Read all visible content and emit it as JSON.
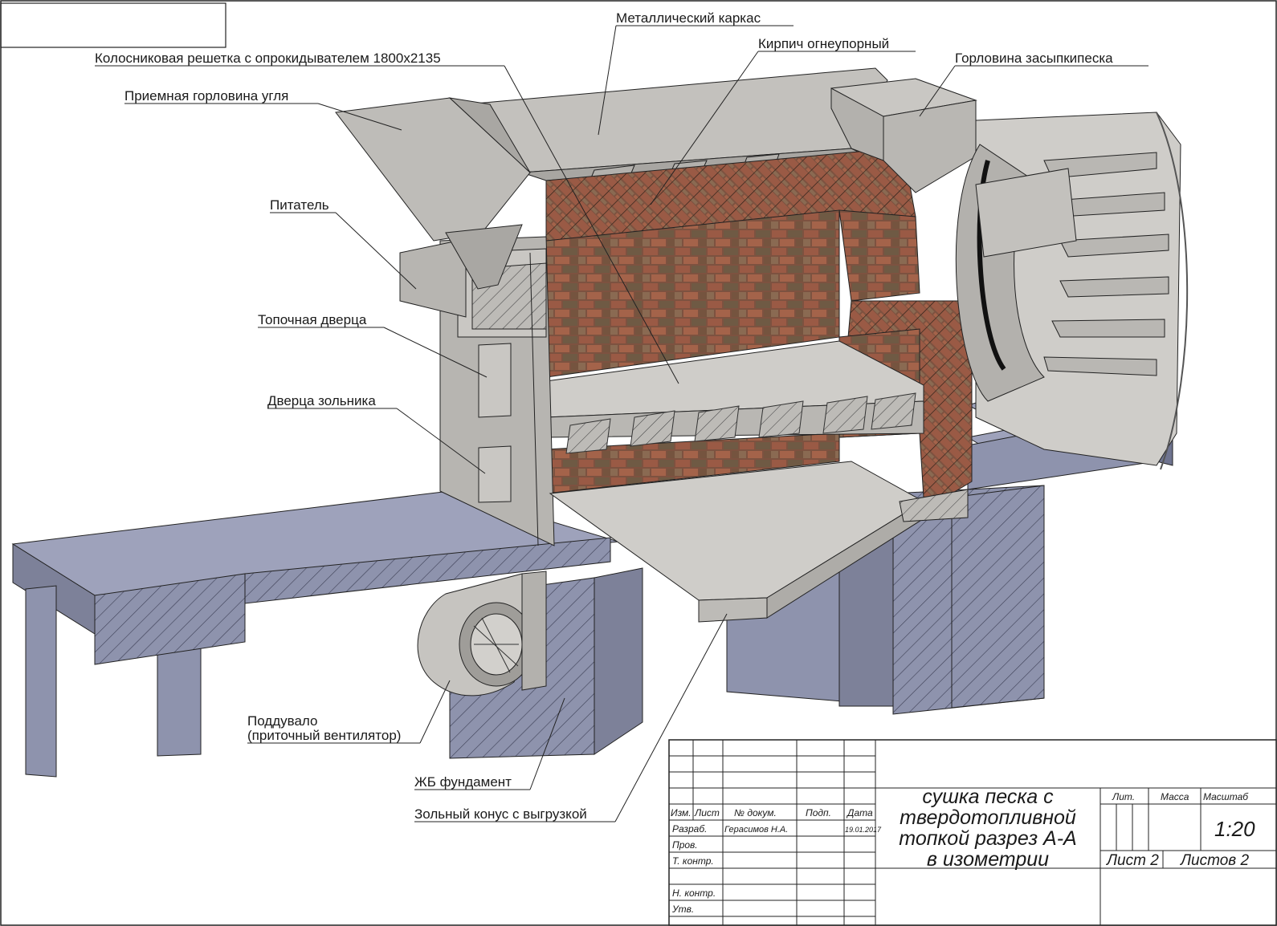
{
  "drawing": {
    "labels": [
      "Металлический каркас",
      "Кирпич огнеупорный",
      "Колосниковая решетка с опрокидывателем 1800х2135",
      "Горловина засыпкипеска",
      "Приемная горловина угля",
      "Питатель",
      "Топочная дверца",
      "Дверца зольника",
      "Поддувало",
      "(приточный вентилятор)",
      "ЖБ фундамент",
      "Зольный конус с выгрузкой"
    ]
  },
  "title_block": {
    "headers": [
      "Изм.",
      "Лист",
      "№ докум.",
      "Подп.",
      "Дата"
    ],
    "rows": [
      {
        "role": "Разраб.",
        "name": "Герасимов Н.А.",
        "date": "19.01.2017"
      },
      {
        "role": "Пров.",
        "name": "",
        "date": ""
      },
      {
        "role": "Т. контр.",
        "name": "",
        "date": ""
      },
      {
        "role": "Н. контр.",
        "name": "",
        "date": ""
      },
      {
        "role": "Утв.",
        "name": "",
        "date": ""
      }
    ],
    "title_lines": [
      "сушка песка с",
      "твердотопливной",
      "топкой разрез А-А",
      "в изометрии"
    ],
    "lit_label": "Лит.",
    "mass_label": "Масса",
    "scale_label": "Масштаб",
    "scale_value": "1:20",
    "sheet": "Лист 2",
    "sheets": "Листов 2"
  },
  "colors": {
    "foundation": "#8e93ad",
    "foundation_dark": "#6f7490",
    "steel": "#c8c6c2",
    "steel_dark": "#9a9894",
    "brick": "#8a5a44",
    "brick_dark": "#5e4030"
  }
}
